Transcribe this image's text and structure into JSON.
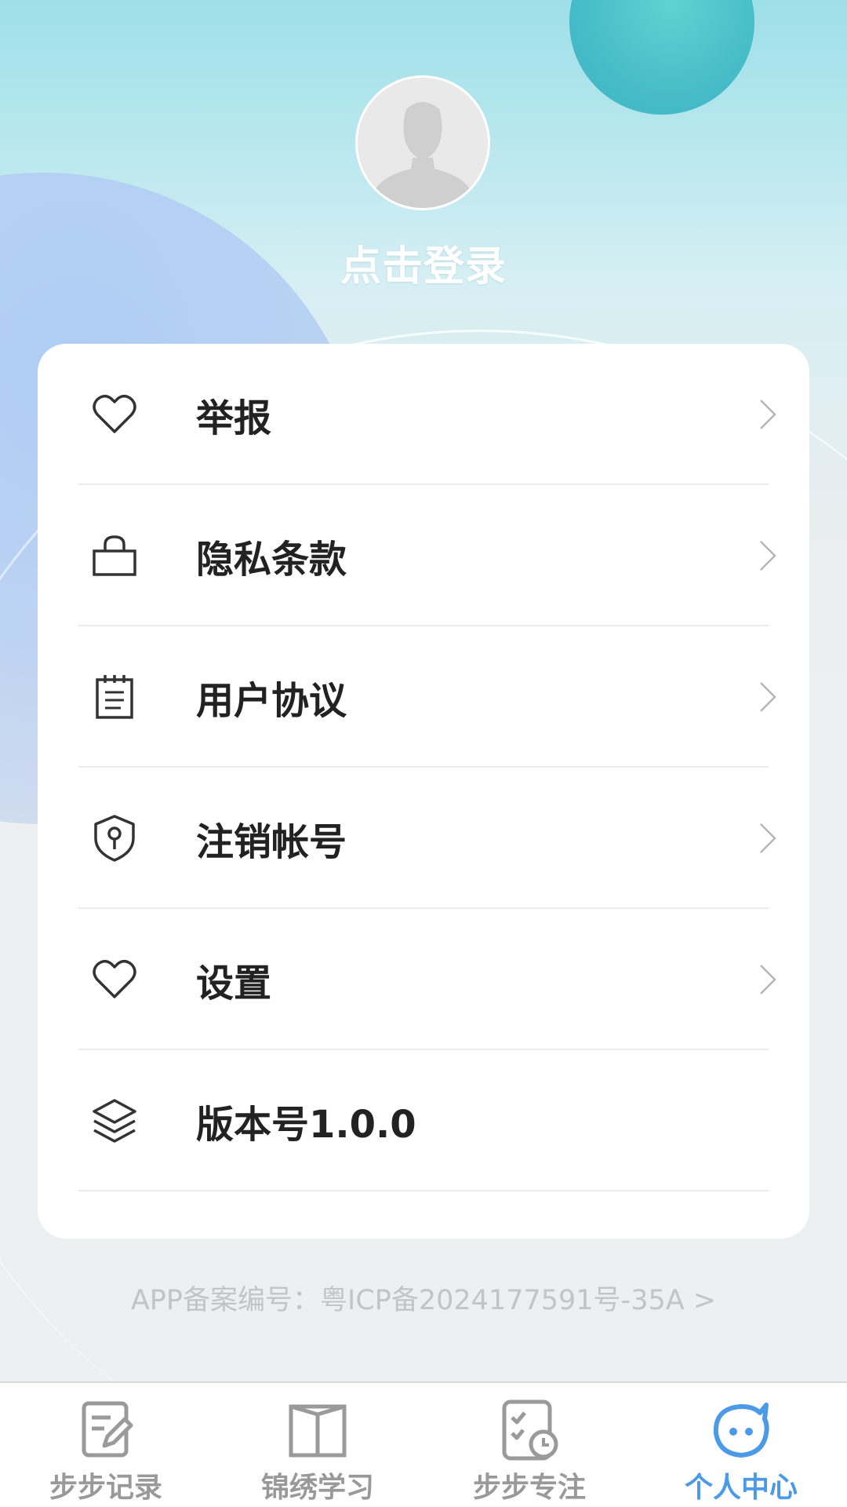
{
  "profile": {
    "login_label": "点击登录"
  },
  "menu": [
    {
      "label": "举报",
      "icon": "heart-icon",
      "has_chevron": true
    },
    {
      "label": "隐私条款",
      "icon": "lock-icon",
      "has_chevron": true
    },
    {
      "label": "用户协议",
      "icon": "document-icon",
      "has_chevron": true
    },
    {
      "label": "注销帐号",
      "icon": "shield-key-icon",
      "has_chevron": true
    },
    {
      "label": "设置",
      "icon": "heart-icon",
      "has_chevron": true
    },
    {
      "label": "版本号1.0.0",
      "icon": "layers-icon",
      "has_chevron": false
    }
  ],
  "footer": {
    "icp_text": "APP备案编号：粤ICP备2024177591号-35A >"
  },
  "tabbar": {
    "items": [
      {
        "label": "步步记录",
        "icon": "edit-note-icon",
        "active": false
      },
      {
        "label": "锦绣学习",
        "icon": "book-icon",
        "active": false
      },
      {
        "label": "步步专注",
        "icon": "checklist-clock-icon",
        "active": false
      },
      {
        "label": "个人中心",
        "icon": "smiley-icon",
        "active": true
      }
    ]
  },
  "colors": {
    "accent": "#4a9ae8",
    "inactive_tab": "#999999",
    "label_text": "#222222",
    "icp_text": "#c2c4c7"
  }
}
